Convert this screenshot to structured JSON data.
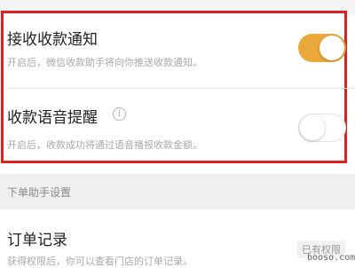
{
  "settings": {
    "receive_notification": {
      "title": "接收收款通知",
      "description": "开启后，微信收款助手将向你推送收款通知。",
      "enabled": true
    },
    "voice_reminder": {
      "title": "收款语音提醒",
      "info_icon_glyph": "i",
      "description": "开启后，收款成功将通过语音播报收款金额。",
      "enabled": false
    }
  },
  "order_assistant": {
    "section_title": "下单助手设置",
    "order_records": {
      "title": "订单记录",
      "description": "获得权限后，你可以查看门店的订单记录。",
      "badge": "已有权限"
    }
  },
  "watermark": "booso.com",
  "colors": {
    "toggle_on": "#e9a93b",
    "highlight_border": "#e02020",
    "section_background": "#efefef"
  },
  "icons": {
    "info": "info-icon"
  }
}
